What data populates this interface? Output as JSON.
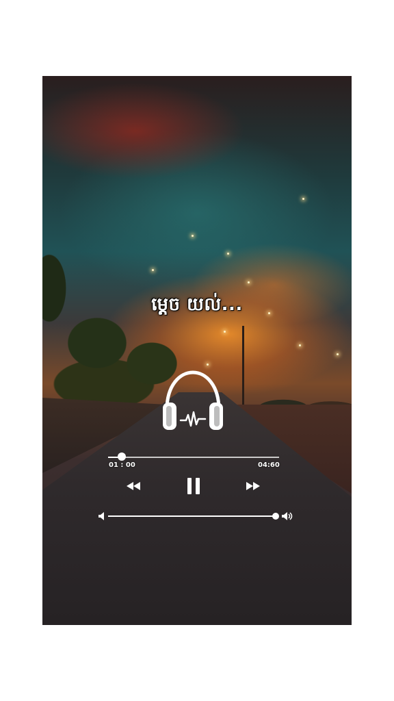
{
  "player": {
    "title": "ម្ដេច យល់...",
    "time_elapsed": "01 : 00",
    "time_total": "04:60",
    "progress_fraction": 0.08,
    "volume_fraction": 1.0
  },
  "controls": {
    "rewind_icon": "rewind-icon",
    "pause_icon": "pause-icon",
    "forward_icon": "fast-forward-icon"
  },
  "decor": {
    "center_icon": "headphones-icon"
  },
  "colors": {
    "ui_foreground": "#ffffff",
    "page_background": "#ffffff"
  }
}
